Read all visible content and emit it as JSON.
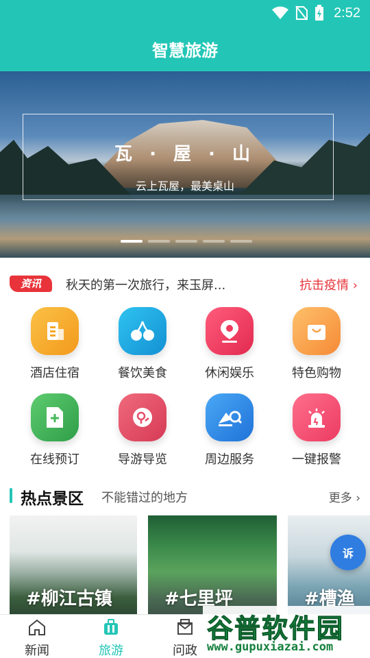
{
  "status": {
    "time": "2:52"
  },
  "header": {
    "title": "智慧旅游"
  },
  "banner": {
    "title": "瓦 · 屋 · 山",
    "subtitle": "云上瓦屋，最美桌山",
    "page_count": 5,
    "active_index": 0
  },
  "news": {
    "badge": "资讯",
    "text": "秋天的第一次旅行，来玉屏...",
    "link": "抗击疫情 ›"
  },
  "grid": [
    {
      "label": "酒店住宿",
      "icon": "hotel-building-icon",
      "color": "#f5a623"
    },
    {
      "label": "餐饮美食",
      "icon": "cherry-icon",
      "color": "#1aa6e0"
    },
    {
      "label": "休闲娱乐",
      "icon": "location-pin-icon",
      "color": "#ef3b5e"
    },
    {
      "label": "特色购物",
      "icon": "shopping-bag-icon",
      "color": "#f8a24a"
    },
    {
      "label": "在线预订",
      "icon": "add-document-icon",
      "color": "#46b85a"
    },
    {
      "label": "导游导览",
      "icon": "guide-pin-icon",
      "color": "#e54e6a"
    },
    {
      "label": "周边服务",
      "icon": "surrounding-search-icon",
      "color": "#2f8de8"
    },
    {
      "label": "一键报警",
      "icon": "alarm-siren-icon",
      "color": "#f04a6c"
    }
  ],
  "section": {
    "title": "热点景区",
    "subtitle": "不能错过的地方",
    "more": "更多 ›"
  },
  "cards": [
    {
      "label": "#柳江古镇"
    },
    {
      "label": "#七里坪"
    },
    {
      "label": "#槽渔"
    }
  ],
  "float_button": {
    "label": "诉"
  },
  "tabs": [
    {
      "label": "新闻",
      "icon": "home-icon",
      "active": false
    },
    {
      "label": "旅游",
      "icon": "suitcase-icon",
      "active": true
    },
    {
      "label": "问政",
      "icon": "mail-icon",
      "active": false
    }
  ],
  "watermark": {
    "title": "谷普软件园",
    "url": "www.gupuxiazai.com"
  }
}
